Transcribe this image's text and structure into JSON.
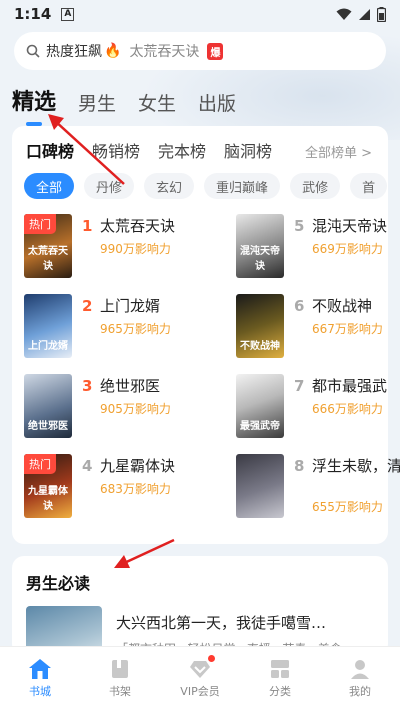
{
  "status": {
    "time": "1:14",
    "notification": "A"
  },
  "search": {
    "hot_label": "热度狂飙",
    "keyword": "太荒吞天诀",
    "badge": "爆"
  },
  "top_tabs": [
    "精选",
    "男生",
    "女生",
    "出版"
  ],
  "rank_tabs": [
    "口碑榜",
    "畅销榜",
    "完本榜",
    "脑洞榜"
  ],
  "all_rank": "全部榜单 >",
  "chips": [
    "全部",
    "丹修",
    "玄幻",
    "重归巅峰",
    "武修",
    "首"
  ],
  "books": [
    {
      "rank": "1",
      "title": "太荒吞天诀",
      "meta": "990万影响力",
      "tag": "热门",
      "cover_text": "太荒吞天诀"
    },
    {
      "rank": "2",
      "title": "上门龙婿",
      "meta": "965万影响力",
      "tag": "",
      "cover_text": "上门龙婿"
    },
    {
      "rank": "3",
      "title": "绝世邪医",
      "meta": "905万影响力",
      "tag": "",
      "cover_text": "绝世邪医"
    },
    {
      "rank": "4",
      "title": "九星霸体诀",
      "meta": "683万影响力",
      "tag": "热门",
      "cover_text": "九星霸体诀"
    },
    {
      "rank": "5",
      "title": "混沌天帝诀",
      "meta": "669万影响力",
      "tag": "",
      "cover_text": "混沌天帝诀"
    },
    {
      "rank": "6",
      "title": "不败战神",
      "meta": "667万影响力",
      "tag": "",
      "cover_text": "不败战神"
    },
    {
      "rank": "7",
      "title": "都市最强武",
      "meta": "666万影响力",
      "tag": "",
      "cover_text": "最强武帝"
    },
    {
      "rank": "8",
      "title": "浮生未歇，清愁",
      "meta": "655万影响力",
      "tag": "",
      "cover_text": ""
    }
  ],
  "section": {
    "title": "男生必读",
    "book_title": "大兴西北第一天，我徒手噶雪…",
    "book_desc": "「都市种田 · 轻松日常 · 直播 · 节奏 · 美食"
  },
  "nav": [
    {
      "label": "书城",
      "icon": "home-icon"
    },
    {
      "label": "书架",
      "icon": "bookshelf-icon"
    },
    {
      "label": "VIP会员",
      "icon": "vip-icon"
    },
    {
      "label": "分类",
      "icon": "category-icon"
    },
    {
      "label": "我的",
      "icon": "profile-icon"
    }
  ],
  "colors": {
    "accent": "#2b8cff",
    "hot": "#ff5b2e",
    "meta": "#f0a030",
    "annotation": "#e02020"
  }
}
